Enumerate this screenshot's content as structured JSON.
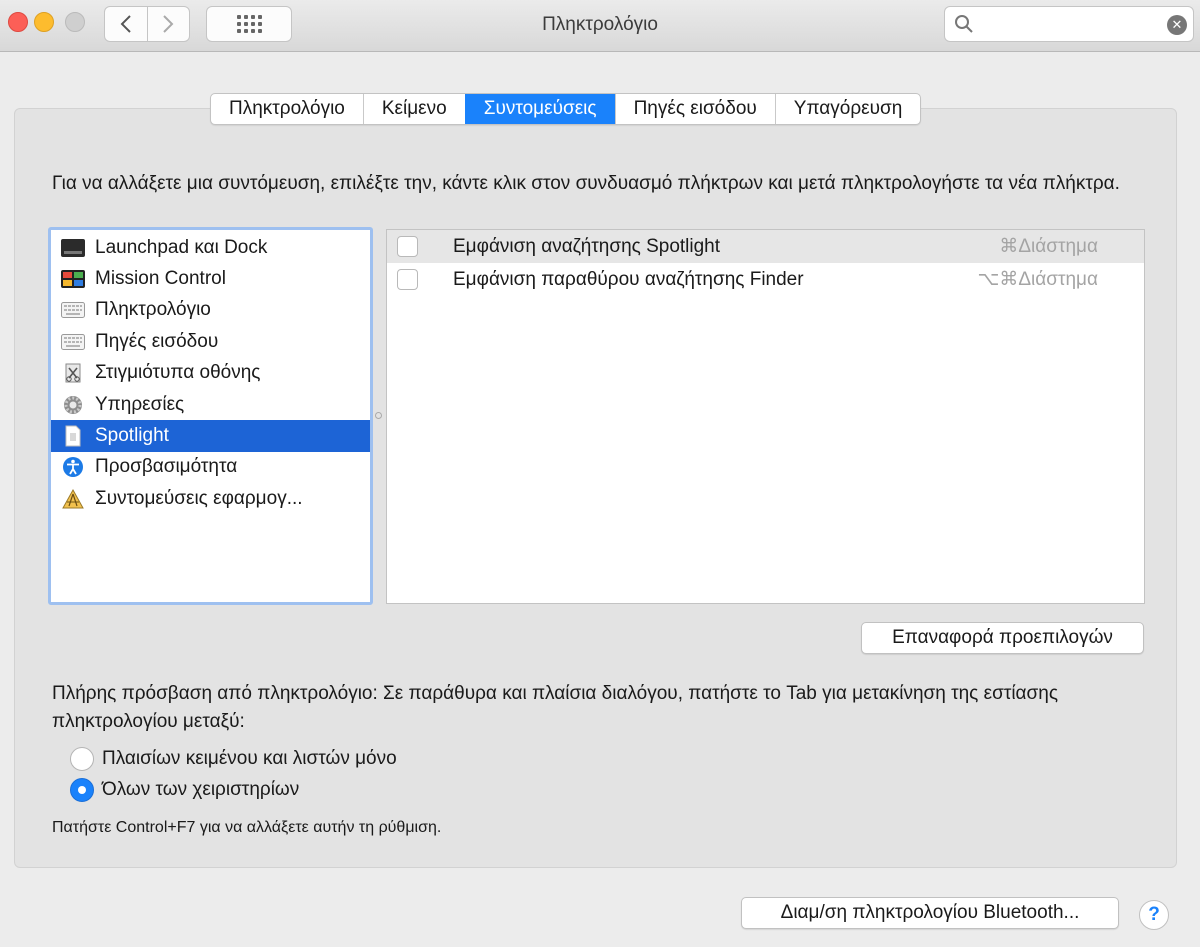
{
  "window": {
    "title": "Πληκτρολόγιο"
  },
  "search": {
    "placeholder": "",
    "value": ""
  },
  "tabs": [
    {
      "label": "Πληκτρολόγιο",
      "active": false
    },
    {
      "label": "Κείμενο",
      "active": false
    },
    {
      "label": "Συντομεύσεις",
      "active": true
    },
    {
      "label": "Πηγές εισόδου",
      "active": false
    },
    {
      "label": "Υπαγόρευση",
      "active": false
    }
  ],
  "description": "Για να αλλάξετε μια συντόμευση, επιλέξτε την, κάντε κλικ στον συνδυασμό πλήκτρων και μετά πληκτρολογήστε τα νέα πλήκτρα.",
  "categories": [
    {
      "label": "Launchpad και Dock",
      "icon": "launchpad-icon"
    },
    {
      "label": "Mission Control",
      "icon": "mission-control-icon"
    },
    {
      "label": "Πληκτρολόγιο",
      "icon": "keyboard-icon"
    },
    {
      "label": "Πηγές εισόδου",
      "icon": "keyboard-icon"
    },
    {
      "label": "Στιγμιότυπα οθόνης",
      "icon": "screenshot-icon"
    },
    {
      "label": "Υπηρεσίες",
      "icon": "gear-icon"
    },
    {
      "label": "Spotlight",
      "icon": "document-icon",
      "selected": true
    },
    {
      "label": "Προσβασιμότητα",
      "icon": "accessibility-icon"
    },
    {
      "label": "Συντομεύσεις εφαρμογ...",
      "icon": "app-shortcuts-icon"
    }
  ],
  "shortcuts": [
    {
      "label": "Εμφάνιση αναζήτησης Spotlight",
      "keys": "⌘Διάστημα",
      "checked": false
    },
    {
      "label": "Εμφάνιση παραθύρου αναζήτησης Finder",
      "keys": "⌥⌘Διάστημα",
      "checked": false
    }
  ],
  "reset_button": "Επαναφορά προεπιλογών",
  "keyboard_access": {
    "text": "Πλήρης πρόσβαση από πληκτρολόγιο: Σε παράθυρα και πλαίσια διαλόγου, πατήστε το Tab για μετακίνηση της εστίασης πληκτρολογίου μεταξύ:",
    "options": [
      {
        "label": "Πλαισίων κειμένου και λιστών μόνο",
        "checked": false
      },
      {
        "label": "Όλων των χειριστηρίων",
        "checked": true
      }
    ],
    "hint": "Πατήστε Control+F7 για να αλλάξετε αυτήν τη ρύθμιση."
  },
  "bluetooth_button": "Διαμ/ση πληκτρολογίου Bluetooth...",
  "help_label": "?",
  "colors": {
    "accent": "#1a82fb",
    "selection": "#1d64d6"
  }
}
